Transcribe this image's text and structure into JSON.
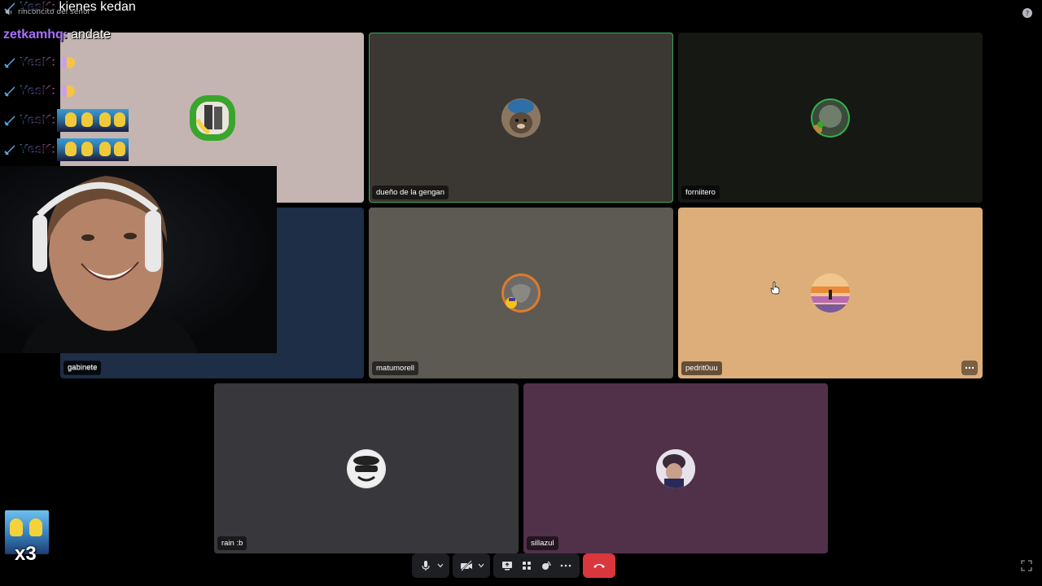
{
  "channel": {
    "title": "rinconcito del señor"
  },
  "colors": {
    "disconnect": "#da373c",
    "speaking_border": "#3ba55d",
    "username_yesk_gradient": [
      "#4fc3f7",
      "#b388ff",
      "#ff80ab"
    ],
    "username_zetkamhq": "#a970ff"
  },
  "chat": {
    "lines": [
      {
        "user": "YesK:",
        "message": "kienes kedan",
        "badge": "sword-icon"
      },
      {
        "user": "zetkamhq:",
        "message": "andate",
        "badge": ""
      },
      {
        "user": "YesK:",
        "message": "",
        "badge": "sword-icon",
        "emote": "hand-emote"
      },
      {
        "user": "YesK:",
        "message": "",
        "badge": "sword-icon",
        "emote": "hand-emote"
      },
      {
        "user": "YesK:",
        "message": "",
        "badge": "sword-icon",
        "emote": "minions-emote"
      },
      {
        "user": "YesK:",
        "message": "",
        "badge": "sword-icon",
        "emote": "minions-emote"
      }
    ]
  },
  "participants": [
    {
      "name": "",
      "bg": "#c4b4b2",
      "avatar_ring": "#3aa52c",
      "speaking": false
    },
    {
      "name": "dueño de la gengan",
      "bg": "#3b3834",
      "speaking": true
    },
    {
      "name": "forniitero",
      "bg": "#161814",
      "avatar_ring": "#2fb34a",
      "speaking": false
    },
    {
      "name": "gabinete",
      "bg": "#1d2e46",
      "speaking": false
    },
    {
      "name": "matumorell",
      "bg": "#5c5a52",
      "avatar_ring": "#e07a2c",
      "speaking": false
    },
    {
      "name": "pedrit0uu",
      "bg": "#ddae7a",
      "speaking": false
    },
    {
      "name": "rain :b",
      "bg": "#38373b",
      "speaking": false
    },
    {
      "name": "sillazul",
      "bg": "#51304a",
      "speaking": false
    }
  ],
  "controls": {
    "mic": "microphone-icon",
    "camera": "camera-off-icon",
    "screen_share": "screen-share-icon",
    "activities": "activities-icon",
    "soundboard": "soundboard-icon",
    "more": "more-icon",
    "disconnect": "disconnect-icon"
  },
  "overlay": {
    "emote_multiplier": "x3"
  }
}
